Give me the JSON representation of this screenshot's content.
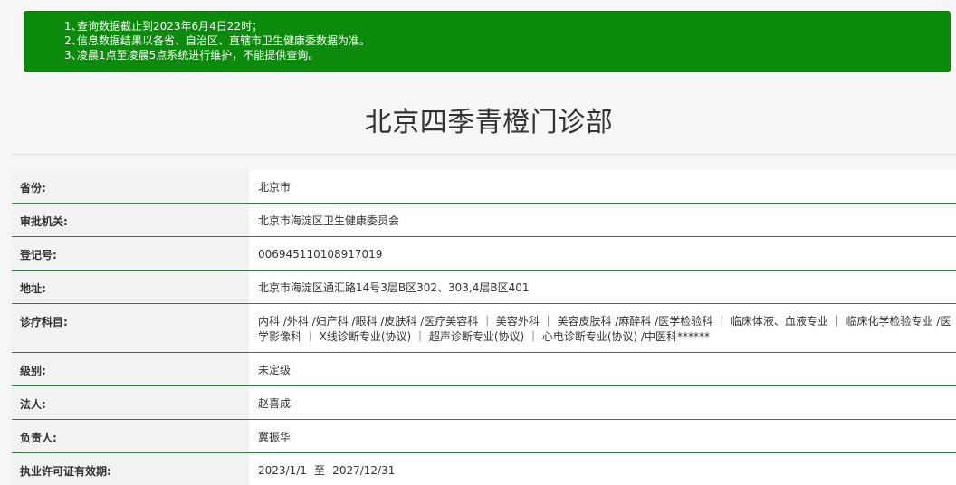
{
  "notice": {
    "lines": [
      {
        "num": "1、",
        "text": "查询数据截止到2023年6月4日22时；"
      },
      {
        "num": "2、",
        "text": "信息数据结果以各省、自治区、直辖市卫生健康委数据为准。"
      },
      {
        "num": "3、",
        "text": "凌晨1点至凌晨5点系统进行维护，不能提供查询。"
      }
    ]
  },
  "page": {
    "title": "北京四季青橙门诊部"
  },
  "info": {
    "rows": [
      {
        "label": "省份:",
        "value": "北京市"
      },
      {
        "label": "审批机关:",
        "value": "北京市海淀区卫生健康委员会"
      },
      {
        "label": "登记号:",
        "value": "006945110108917019"
      },
      {
        "label": "地址:",
        "value": "北京市海淀区通汇路14号3层B区302、303,4层B区401"
      },
      {
        "label": "诊疗科目:",
        "value": "内科 /外科 /妇产科 /眼科 /皮肤科 /医疗美容科 ｜ 美容外科 ｜ 美容皮肤科 /麻醉科 /医学检验科 ｜ 临床体液、血液专业 ｜ 临床化学检验专业 /医学影像科 ｜ X线诊断专业(协议) ｜ 超声诊断专业(协议) ｜ 心电诊断专业(协议) /中医科******"
      },
      {
        "label": "级别:",
        "value": "未定级"
      },
      {
        "label": "法人:",
        "value": "赵喜成"
      },
      {
        "label": "负责人:",
        "value": "冀振华"
      },
      {
        "label": "执业许可证有效期:",
        "value": "2023/1/1 -至- 2027/12/31"
      }
    ]
  }
}
